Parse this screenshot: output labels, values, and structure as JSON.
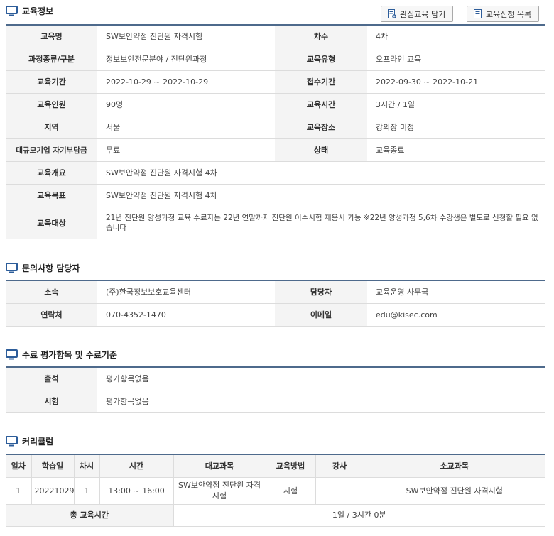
{
  "edu_info": {
    "title": "교육정보",
    "buttons": {
      "wishlist": "관심교육 담기",
      "apply_list": "교육신청 목록"
    },
    "rows": [
      {
        "l1": "교육명",
        "v1": "SW보안약점 진단원 자격시험",
        "l2": "차수",
        "v2": "4차"
      },
      {
        "l1": "과정종류/구분",
        "v1": "정보보안전문분야 / 진단원과정",
        "l2": "교육유형",
        "v2": "오프라인 교육"
      },
      {
        "l1": "교육기간",
        "v1": "2022-10-29 ~ 2022-10-29",
        "l2": "접수기간",
        "v2": "2022-09-30 ~ 2022-10-21"
      },
      {
        "l1": "교육인원",
        "v1": "90명",
        "l2": "교육시간",
        "v2": "3시간 / 1일"
      },
      {
        "l1": "지역",
        "v1": "서울",
        "l2": "교육장소",
        "v2": "강의장 미정"
      },
      {
        "l1": "대규모기업 자기부담금",
        "v1": "무료",
        "l2": "상태",
        "v2": "교육종료"
      }
    ],
    "overview_label": "교육개요",
    "overview": "SW보안약점 진단원 자격시험 4차",
    "goal_label": "교육목표",
    "goal": "SW보안약점 진단원 자격시험 4차",
    "target_label": "교육대상",
    "target": "21년 진단원 양성과정 교육 수료자는 22년 연말까지 진단원 이수시험 재응시 가능 ※22년 양성과정 5,6차 수강생은 별도로 신청할 필요 없습니다"
  },
  "contact": {
    "title": "문의사항 담당자",
    "rows": [
      {
        "l1": "소속",
        "v1": "(주)한국정보보호교육센터",
        "l2": "담당자",
        "v2": "교육운영 사무국"
      },
      {
        "l1": "연락처",
        "v1": "070-4352-1470",
        "l2": "이메일",
        "v2": "edu@kisec.com"
      }
    ]
  },
  "criteria": {
    "title": "수료 평가항목 및 수료기준",
    "rows": [
      {
        "label": "출석",
        "value": "평가항목없음"
      },
      {
        "label": "시험",
        "value": "평가항목없음"
      }
    ]
  },
  "curriculum": {
    "title": "커리큘럼",
    "headers": [
      "일차",
      "학습일",
      "차시",
      "시간",
      "대교과목",
      "교육방법",
      "강사",
      "소교과목"
    ],
    "row": [
      "1",
      "20221029",
      "1",
      "13:00 ~ 16:00",
      "SW보안약점 진단원 자격시험",
      "시험",
      "",
      "SW보안약점 진단원 자격시험"
    ],
    "total_label": "총 교육시간",
    "total_value": "1일 / 3시간 0분"
  },
  "icons": {
    "section": "monitor-icon",
    "wishlist": "add-document-icon",
    "apply_list": "list-document-icon"
  },
  "colors": {
    "table_border": "#4e6a8c",
    "icon_blue": "#2d5d9a",
    "header_bg": "#f4f4f4"
  }
}
